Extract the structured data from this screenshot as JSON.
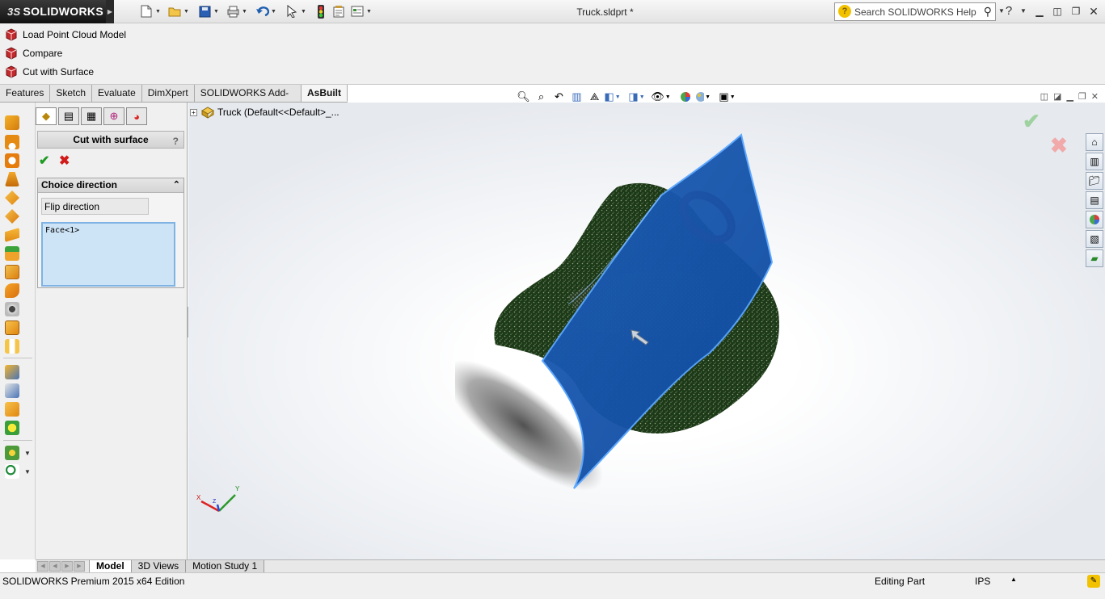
{
  "app": {
    "logo": "SOLIDWORKS",
    "logo_mark": "3S",
    "document_title": "Truck.sldprt *"
  },
  "search": {
    "placeholder": "Search SOLIDWORKS Help"
  },
  "commands": [
    {
      "label": "Load Point Cloud Model"
    },
    {
      "label": "Compare"
    },
    {
      "label": "Cut with Surface"
    }
  ],
  "tabs": [
    {
      "label": "Features"
    },
    {
      "label": "Sketch"
    },
    {
      "label": "Evaluate"
    },
    {
      "label": "DimXpert"
    },
    {
      "label": "SOLIDWORKS Add-Ins"
    },
    {
      "label": "AsBuilt",
      "active": true
    }
  ],
  "property_manager": {
    "title": "Cut with surface",
    "help": "?",
    "group_title": "Choice direction",
    "flip_button": "Flip direction",
    "selection": "Face<1>"
  },
  "tree": {
    "root": "Truck  (Default<<Default>_..."
  },
  "bottom_tabs": [
    {
      "label": "Model",
      "active": true
    },
    {
      "label": "3D Views"
    },
    {
      "label": "Motion Study 1"
    }
  ],
  "status": {
    "product": "SOLIDWORKS Premium 2015 x64 Edition",
    "mode": "Editing Part",
    "units": "IPS"
  },
  "triad": {
    "x": "X",
    "y": "Y",
    "z": "Z"
  },
  "colors": {
    "surface": "#1c5fb4",
    "point_cloud": "#1f3d1a",
    "ring": "#b0121a",
    "accent": "#1f9a23",
    "cancel": "#d11a1a"
  }
}
